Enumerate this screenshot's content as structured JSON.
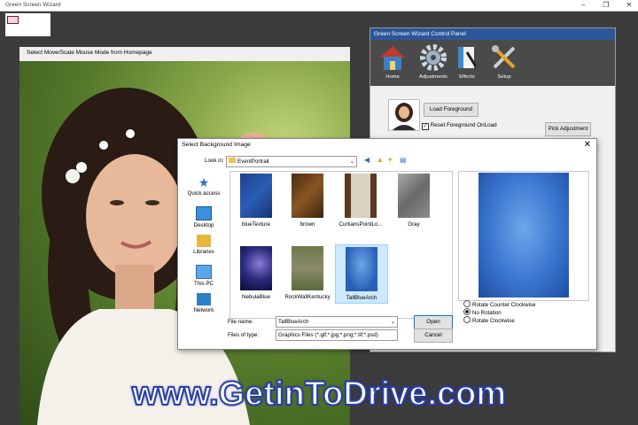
{
  "app": {
    "title": "Green Screen Wizard"
  },
  "photo_panel": {
    "header": "Select Move/Scale Mouse Mode from Homepage"
  },
  "control_panel": {
    "title": "Green Screen Wizard Control Panel",
    "tools": [
      {
        "label": "Home",
        "icon": "home-icon"
      },
      {
        "label": "Adjustments",
        "icon": "gear-icon"
      },
      {
        "label": "Effects",
        "icon": "effects-icon"
      },
      {
        "label": "Setup",
        "icon": "tools-icon"
      }
    ],
    "load_foreground": "Load Foreground",
    "reset_foreground": "Reset Foreground OnLoad",
    "pick_adjustment": "Pick Adjustment"
  },
  "dialog": {
    "title": "Select Background Image",
    "look_in_label": "Look in:",
    "look_in_value": "EventPortrait",
    "places": [
      {
        "label": "Quick access",
        "icon": "star-icon"
      },
      {
        "label": "Desktop",
        "icon": "desktop-icon"
      },
      {
        "label": "Libraries",
        "icon": "libraries-icon"
      },
      {
        "label": "This PC",
        "icon": "computer-icon"
      },
      {
        "label": "Network",
        "icon": "network-icon"
      }
    ],
    "files": [
      {
        "name": "blueTexture"
      },
      {
        "name": "brown"
      },
      {
        "name": "CurtiansPointLo..."
      },
      {
        "name": "Gray"
      },
      {
        "name": "NebulaBlue"
      },
      {
        "name": "RockWallKentucky"
      },
      {
        "name": "TallBlueArch"
      }
    ],
    "file_name_label": "File name:",
    "file_name_value": "TallBlueArch",
    "file_type_label": "Files of type:",
    "file_type_value": "Graphics Files (*.gif;*.jpg;*.png;*.tif;*.psd)",
    "open_button": "Open",
    "cancel_button": "Cancel",
    "rotation_options": [
      "Rotate Counter Clockwise",
      "No Rotation",
      "Rotate Clockwise"
    ],
    "selected_rotation": "No Rotation"
  },
  "watermark": "www.GetinToDrive.com",
  "colors": {
    "titlebar_blue": "#2b579a",
    "selection": "#cde8ff",
    "watermark_stroke": "#2a3fa8"
  }
}
